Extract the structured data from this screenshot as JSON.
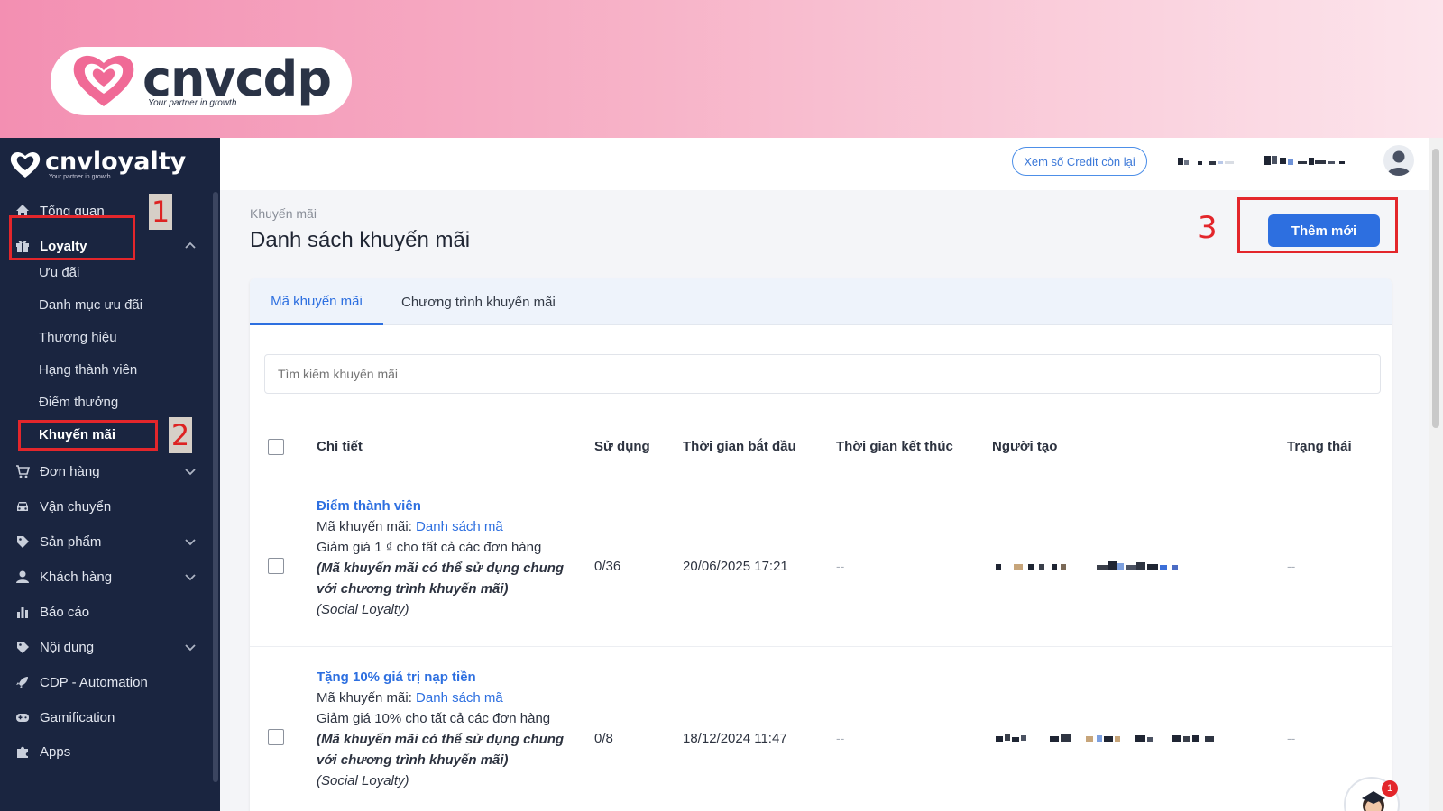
{
  "banner": {
    "brand_name": "cnvcdp",
    "brand_tagline": "Your partner in growth"
  },
  "sidebar": {
    "logo_name": "cnvloyalty",
    "logo_tagline": "Your partner in growth",
    "items": [
      {
        "label": "Tổng quan",
        "icon": "home-icon"
      },
      {
        "label": "Loyalty",
        "icon": "gift-icon",
        "expanded": true
      },
      {
        "label": "Đơn hàng",
        "icon": "cart-icon"
      },
      {
        "label": "Vận chuyển",
        "icon": "car-icon"
      },
      {
        "label": "Sản phẩm",
        "icon": "tag-icon"
      },
      {
        "label": "Khách hàng",
        "icon": "user-icon"
      },
      {
        "label": "Báo cáo",
        "icon": "bar-chart-icon"
      },
      {
        "label": "Nội dung",
        "icon": "tag-icon"
      },
      {
        "label": "CDP - Automation",
        "icon": "rocket-icon"
      },
      {
        "label": "Gamification",
        "icon": "gamepad-icon"
      },
      {
        "label": "Apps",
        "icon": "puzzle-icon"
      }
    ],
    "loyalty_sub": [
      "Ưu đãi",
      "Danh mục ưu đãi",
      "Thương hiệu",
      "Hạng thành viên",
      "Điểm thưởng",
      "Khuyến mãi"
    ],
    "step_markers": [
      "1",
      "2"
    ]
  },
  "header": {
    "credit_button": "Xem số Credit còn lại"
  },
  "page": {
    "breadcrumb": "Khuyến mãi",
    "title": "Danh sách khuyến mãi",
    "step_marker": "3",
    "add_button": "Thêm mới",
    "tabs": [
      "Mã khuyến mãi",
      "Chương trình khuyến mãi"
    ],
    "search_placeholder": "Tìm kiếm khuyến mãi"
  },
  "table": {
    "headers": [
      "Chi tiết",
      "Sử dụng",
      "Thời gian bắt đầu",
      "Thời gian kết thúc",
      "Người tạo",
      "Trạng thái"
    ],
    "rows": [
      {
        "name": "Điểm thành viên",
        "code_label": "Mã khuyến mãi: ",
        "code_link": "Danh sách mã",
        "discount": "Giảm giá 1 ₫ cho tất cả các đơn hàng",
        "note": "(Mã khuyến mãi có thể sử dụng chung với chương trình khuyến mãi)",
        "source": "(Social Loyalty)",
        "usage": "0/36",
        "start": "20/06/2025 17:21",
        "end": "--",
        "status": "--"
      },
      {
        "name": "Tặng 10% giá trị nạp tiền",
        "code_label": "Mã khuyến mãi: ",
        "code_link": "Danh sách mã",
        "discount": "Giảm giá 10% cho tất cả các đơn hàng",
        "note": "(Mã khuyến mãi có thể sử dụng chung với chương trình khuyến mãi)",
        "source": "(Social Loyalty)",
        "usage": "0/8",
        "start": "18/12/2024 11:47",
        "end": "--",
        "status": "--"
      }
    ]
  },
  "helper_badge": "1",
  "colors": {
    "sidebar_bg": "#1a2540",
    "accent": "#2d6fe0",
    "highlight": "#e3262b",
    "banner_pink": "#f38fb2"
  }
}
